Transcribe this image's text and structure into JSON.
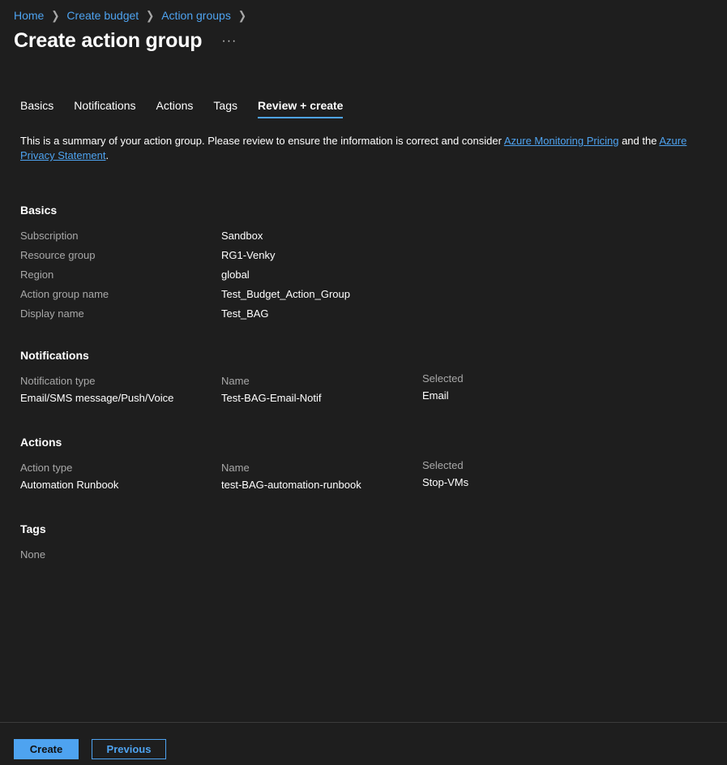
{
  "breadcrumb": {
    "items": [
      "Home",
      "Create budget",
      "Action groups"
    ]
  },
  "header": {
    "title": "Create action group",
    "more": "···"
  },
  "tabs": [
    {
      "label": "Basics"
    },
    {
      "label": "Notifications"
    },
    {
      "label": "Actions"
    },
    {
      "label": "Tags"
    },
    {
      "label": "Review + create"
    }
  ],
  "summary": {
    "text_before": "This is a summary of your action group. Please review to ensure the information is correct and consider ",
    "link1": "Azure Monitoring Pricing",
    "text_middle": " and the ",
    "link2": "Azure Privacy Statement",
    "text_after": "."
  },
  "basics": {
    "title": "Basics",
    "rows": [
      {
        "label": "Subscription",
        "value": "Sandbox"
      },
      {
        "label": "Resource group",
        "value": "RG1-Venky"
      },
      {
        "label": "Region",
        "value": "global"
      },
      {
        "label": "Action group name",
        "value": "Test_Budget_Action_Group"
      },
      {
        "label": "Display name",
        "value": "Test_BAG"
      }
    ]
  },
  "notifications": {
    "title": "Notifications",
    "headers": [
      "Notification type",
      "Name",
      "Selected"
    ],
    "row": [
      "Email/SMS message/Push/Voice",
      "Test-BAG-Email-Notif",
      "Email"
    ]
  },
  "actions": {
    "title": "Actions",
    "headers": [
      "Action type",
      "Name",
      "Selected"
    ],
    "row": [
      "Automation Runbook",
      "test-BAG-automation-runbook",
      "Stop-VMs"
    ]
  },
  "tags": {
    "title": "Tags",
    "value": "None"
  },
  "footer": {
    "create_label": "Create",
    "previous_label": "Previous"
  },
  "colors": {
    "accent": "#4ea3f0",
    "background": "#1e1e1e",
    "muted": "#a8a8a8"
  }
}
